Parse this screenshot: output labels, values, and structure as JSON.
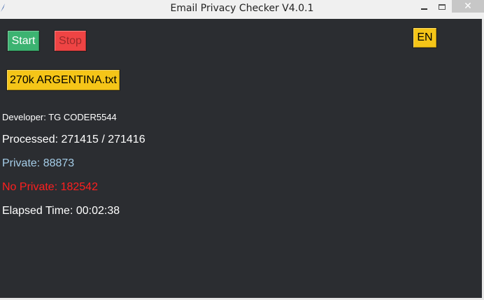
{
  "window": {
    "title": "Email Privacy Checker V4.0.1",
    "close_glyph": "✕",
    "icon": "app-feather-icon"
  },
  "controls": {
    "start_label": "Start",
    "stop_label": "Stop",
    "language_label": "EN",
    "file_label": "270k ARGENTINA.txt"
  },
  "stats": {
    "developer": "Developer: TG CODER5544",
    "processed": "Processed: 271415 / 271416",
    "private": "Private: 88873",
    "no_private": "No Private: 182542",
    "elapsed": "Elapsed Time: 00:02:38"
  },
  "colors": {
    "background": "#2b2d31",
    "start_button": "#3cb371",
    "stop_button": "#ef4444",
    "accent_yellow": "#f5c518",
    "private_text": "#a5cde8",
    "no_private_text": "#ff1f1f"
  }
}
